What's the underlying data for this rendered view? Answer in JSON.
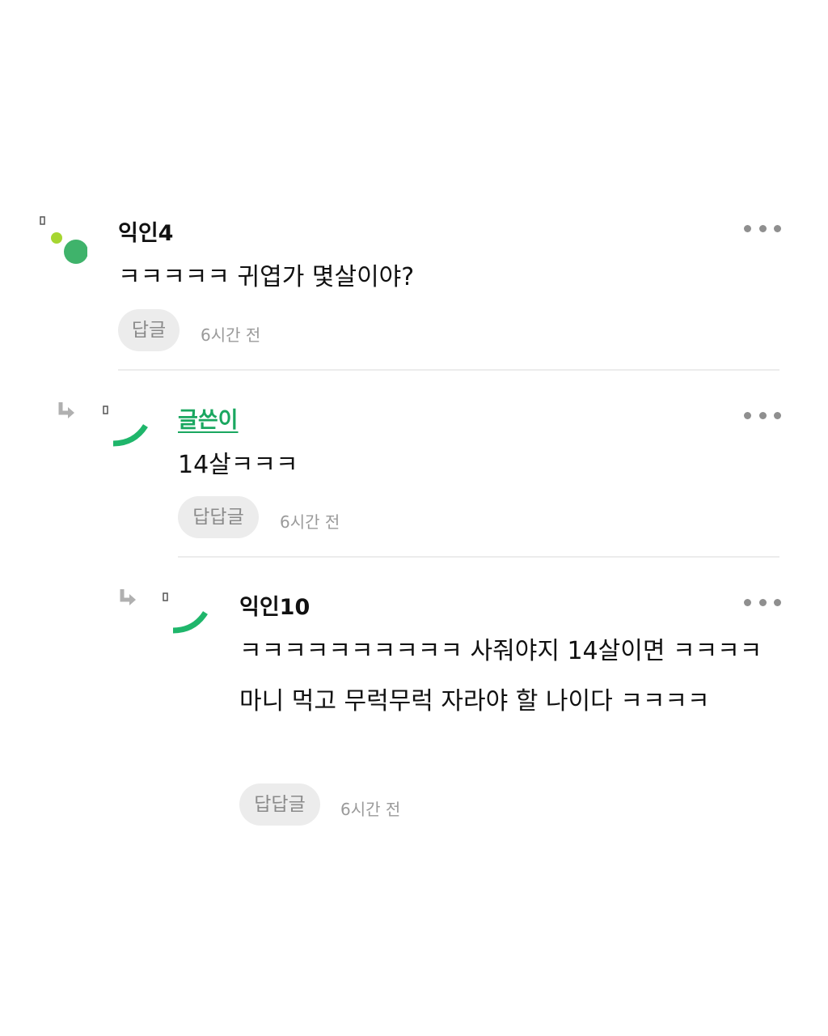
{
  "colors": {
    "op_accent": "#1aa760",
    "avatar_green": "#3fb36b",
    "avatar_lime": "#a6d631",
    "button_bg": "#ececec",
    "muted_text": "#9a9a9a",
    "divider": "#ececec"
  },
  "comments": [
    {
      "author": "익인4",
      "text": "ㅋㅋㅋㅋㅋ 귀엽가 몇살이야?",
      "reply_label": "답글",
      "time": "6시간 전",
      "icon": "more-dots-icon"
    },
    {
      "author": "글쓴이",
      "text": "14살ㅋㅋㅋ",
      "reply_label": "답답글",
      "time": "6시간 전",
      "icon": "more-dots-icon"
    },
    {
      "author": "익인10",
      "text": "ㅋㅋㅋㅋㅋㅋㅋㅋㅋㅋ 사줘야지 14살이면 ㅋㅋㅋㅋ 마니 먹고 무럭무럭 자라야 할 나이다 ㅋㅋㅋㅋ",
      "reply_label": "답답글",
      "time": "6시간 전",
      "icon": "more-dots-icon"
    }
  ]
}
